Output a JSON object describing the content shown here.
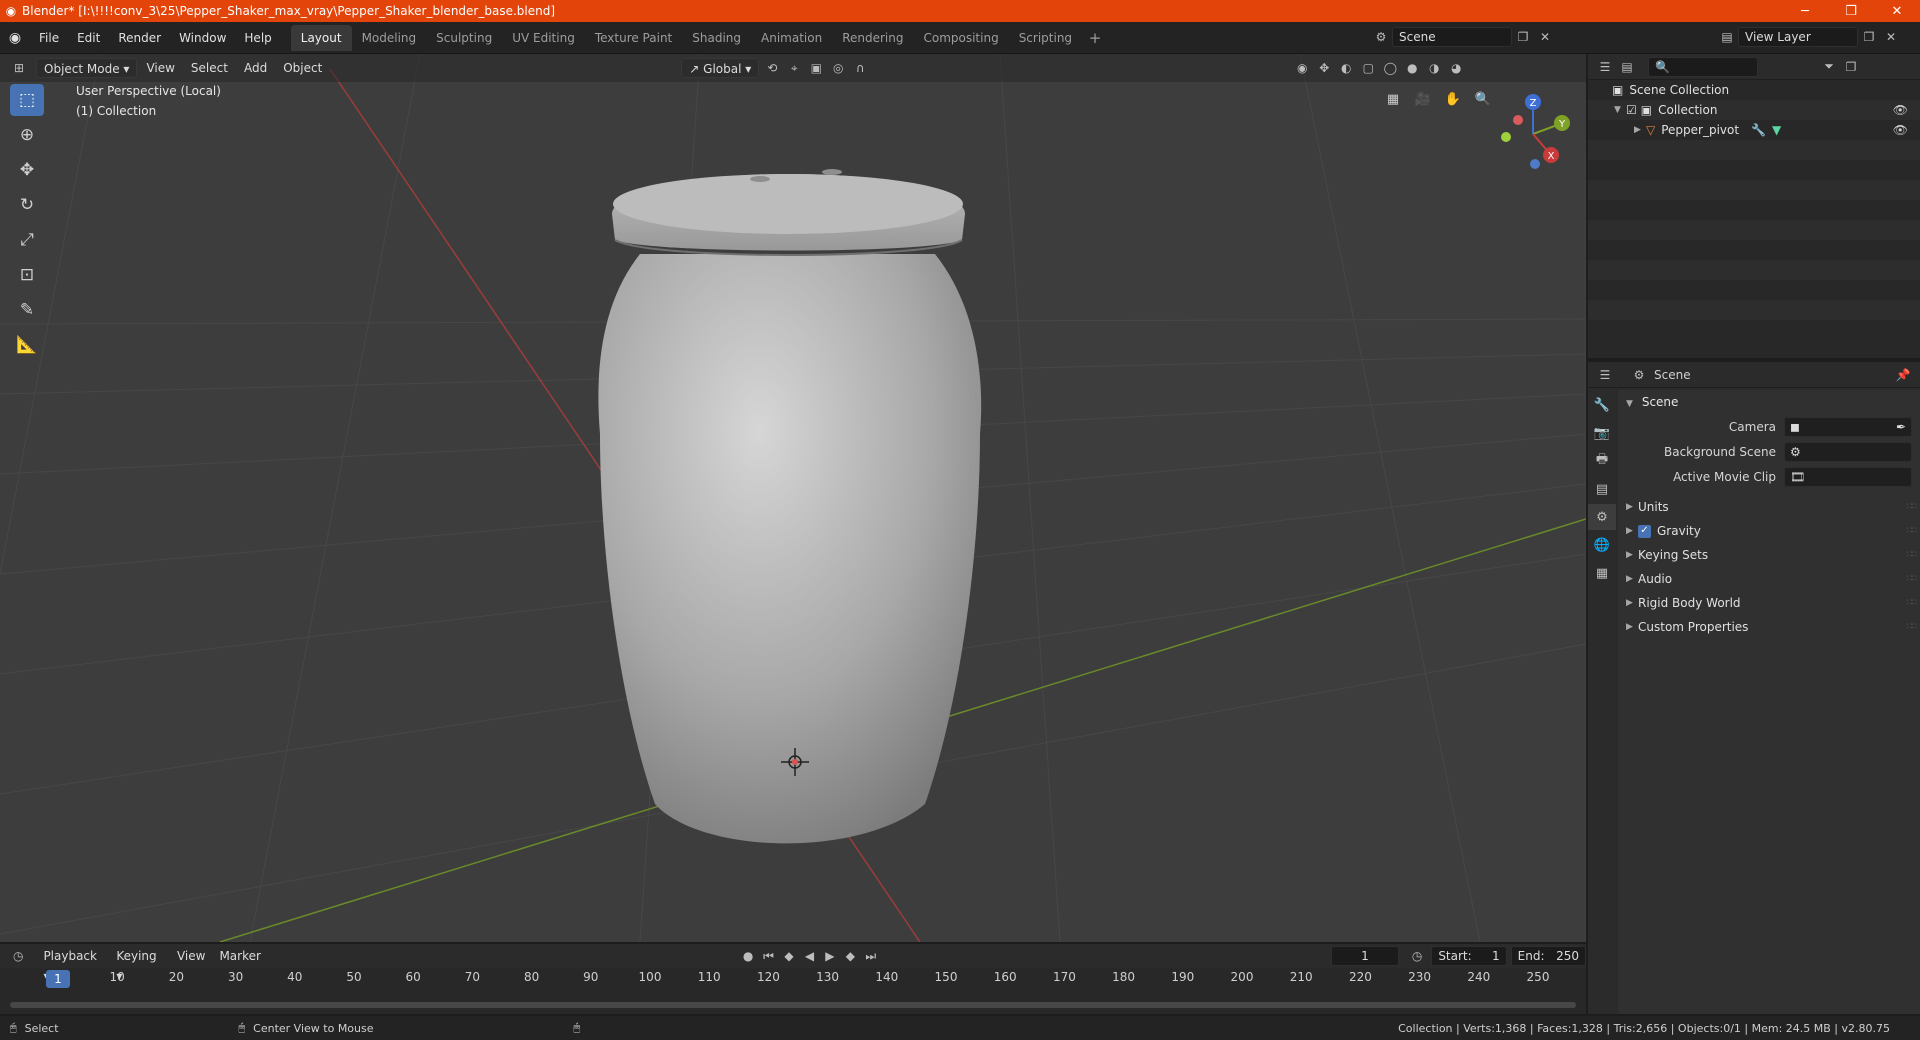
{
  "window": {
    "title": "Blender* [I:\\!!!!conv_3\\25\\Pepper_Shaker_max_vray\\Pepper_Shaker_blender_base.blend]",
    "minimize": "─",
    "maximize": "❐",
    "close": "✕"
  },
  "menus": [
    "File",
    "Edit",
    "Render",
    "Window",
    "Help"
  ],
  "workspaces": [
    "Layout",
    "Modeling",
    "Sculpting",
    "UV Editing",
    "Texture Paint",
    "Shading",
    "Animation",
    "Rendering",
    "Compositing",
    "Scripting"
  ],
  "workspace_add": "+",
  "scene_selector": {
    "value": "Scene"
  },
  "view_layer_selector": {
    "value": "View Layer"
  },
  "viewport": {
    "mode": "Object Mode",
    "menus": [
      "View",
      "Select",
      "Add",
      "Object"
    ],
    "orientation": "Global",
    "overlay_line1": "User Perspective (Local)",
    "overlay_line2": "(1) Collection",
    "axes": {
      "z": "Z",
      "y": "Y",
      "x": "X"
    }
  },
  "outliner": {
    "search_placeholder": "",
    "items": [
      {
        "label": "Scene Collection"
      },
      {
        "label": "Collection"
      },
      {
        "label": "Pepper_pivot"
      }
    ]
  },
  "properties": {
    "context": "Scene",
    "panel": "Scene",
    "fields": [
      {
        "label": "Camera",
        "value": ""
      },
      {
        "label": "Background Scene",
        "value": ""
      },
      {
        "label": "Active Movie Clip",
        "value": ""
      }
    ],
    "subpanels": [
      "Units",
      "Gravity",
      "Keying Sets",
      "Audio",
      "Rigid Body World",
      "Custom Properties"
    ]
  },
  "timeline": {
    "menus": [
      "Playback",
      "Keying",
      "View",
      "Marker"
    ],
    "current_frame": "1",
    "start_label": "Start:",
    "start": "1",
    "end_label": "End:",
    "end": "250",
    "ruler_current": "1",
    "ticks": [
      "10",
      "20",
      "30",
      "40",
      "50",
      "60",
      "70",
      "80",
      "90",
      "100",
      "110",
      "120",
      "130",
      "140",
      "150",
      "160",
      "170",
      "180",
      "190",
      "200",
      "210",
      "220",
      "230",
      "240",
      "250"
    ]
  },
  "statusbar": {
    "left1": "Select",
    "left2": "Center View to Mouse",
    "stats": "Collection | Verts:1,368 | Faces:1,328 | Tris:2,656 | Objects:0/1 | Mem: 24.5 MB | v2.80.75"
  },
  "colors": {
    "titlebar": "#e3440a",
    "accent": "#4772b3",
    "x_axis": "#c93a3a",
    "y_axis": "#7fa126",
    "z_axis": "#3d6fd6"
  }
}
